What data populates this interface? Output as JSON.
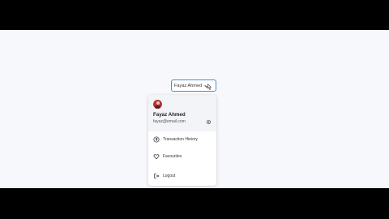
{
  "header": {
    "user_name": "Fayaz Ahmed"
  },
  "menu": {
    "user_name": "Fayaz Ahmed",
    "user_email": "fayaz@email.com",
    "items": [
      {
        "label": "Transaction History",
        "icon": "currency-icon"
      },
      {
        "label": "Favourites",
        "icon": "heart-icon"
      },
      {
        "label": "Logout",
        "icon": "logout-icon"
      }
    ]
  },
  "colors": {
    "accent_border": "#4a8fc9",
    "avatar_bg": "#b5333a",
    "stage_bg": "#f7f8fb"
  }
}
